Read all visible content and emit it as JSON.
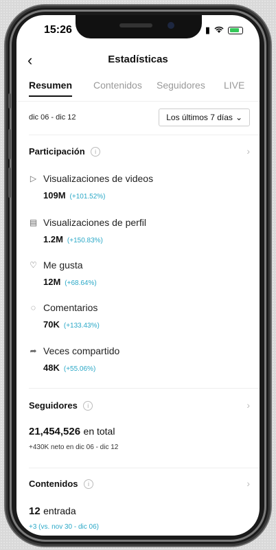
{
  "status": {
    "time": "15:26"
  },
  "header": {
    "title": "Estadísticas"
  },
  "tabs": [
    {
      "label": "Resumen"
    },
    {
      "label": "Contenidos"
    },
    {
      "label": "Seguidores"
    },
    {
      "label": "LIVE"
    }
  ],
  "filter": {
    "date_range": "dic 06 - dic 12",
    "period": "Los últimos 7 días"
  },
  "participation": {
    "title": "Participación",
    "metrics": [
      {
        "label": "Visualizaciones de videos",
        "value": "109M",
        "change": "(+101.52%)",
        "icon": "play-icon"
      },
      {
        "label": "Visualizaciones de perfil",
        "value": "1.2M",
        "change": "(+150.83%)",
        "icon": "profile-doc-icon"
      },
      {
        "label": "Me gusta",
        "value": "12M",
        "change": "(+68.64%)",
        "icon": "heart-icon"
      },
      {
        "label": "Comentarios",
        "value": "70K",
        "change": "(+133.43%)",
        "icon": "comment-icon"
      },
      {
        "label": "Veces compartido",
        "value": "48K",
        "change": "(+55.06%)",
        "icon": "share-icon"
      }
    ]
  },
  "followers": {
    "title": "Seguidores",
    "total": "21,454,526",
    "total_suffix": "en total",
    "net": "+430K neto en dic 06 - dic 12"
  },
  "content": {
    "title": "Contenidos",
    "count": "12",
    "count_suffix": "entrada",
    "compare": "+3 (vs. nov 30 - dic 06)"
  },
  "colors": {
    "accent": "#2aa8c7",
    "text": "#111111",
    "muted": "#999999"
  }
}
